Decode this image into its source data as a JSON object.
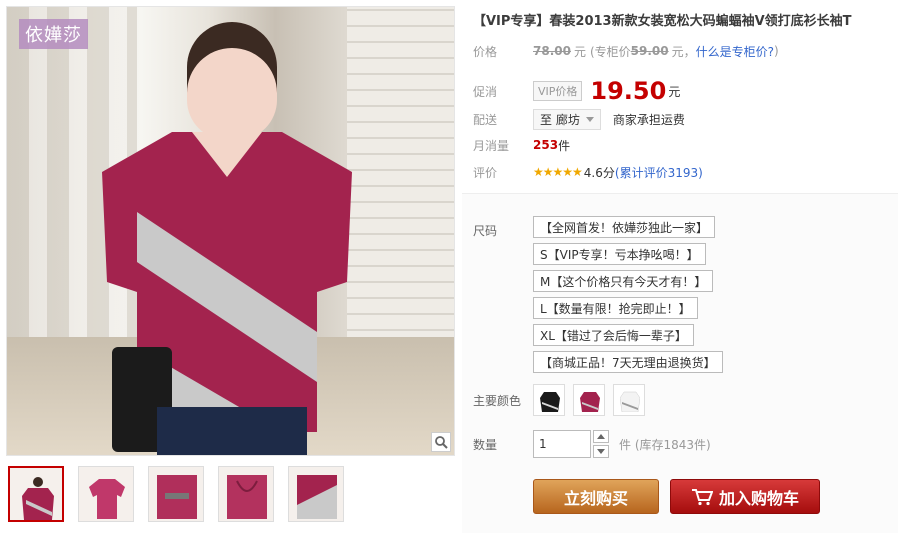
{
  "brand": {
    "logo_text": "依嬅莎"
  },
  "product": {
    "title": "【VIP专享】春装2013新款女装宽松大码蝙蝠袖V领打底衫长袖T"
  },
  "price": {
    "label": "价格",
    "original": "78.00",
    "unit": "元",
    "counter_text": "(专柜价",
    "counter_price": "59.00",
    "counter_unit": "元，",
    "counter_link": "什么是专柜价?",
    "counter_close": ")"
  },
  "promo": {
    "label": "促消",
    "tag": "VIP价格",
    "price": "19.50",
    "unit": "元"
  },
  "delivery": {
    "label": "配送",
    "city": "至 廊坊",
    "note": "商家承担运费"
  },
  "sales": {
    "label": "月消量",
    "count": "253",
    "unit": "件"
  },
  "rating": {
    "label": "评价",
    "stars": "★★★★★",
    "score": "4.6分",
    "reviews_link": "(累计评价3193)"
  },
  "options": {
    "size_label": "尺码",
    "sizes": [
      "【全网首发！依嬅莎独此一家】",
      "S【VIP专享！亏本挣吆喝！】",
      "M【这个价格只有今天才有！】",
      "L【数量有限！抢完即止！】",
      "XL【错过了会后悔一辈子】",
      "【商城正品！7天无理由退换货】"
    ],
    "color_label": "主要颜色",
    "colors": [
      {
        "name": "black-white",
        "main": "#1a1a1a",
        "stripe": "#d8d8d8"
      },
      {
        "name": "rose-grey",
        "main": "#a3234e",
        "stripe": "#c9c9c9"
      },
      {
        "name": "white-grey",
        "main": "#f3f3f3",
        "stripe": "#9a9a9a"
      }
    ],
    "qty_label": "数量",
    "qty_value": "1",
    "stock": "件 (库存1843件)"
  },
  "actions": {
    "buy_now": "立刻购买",
    "add_cart": "加入购物车"
  },
  "colors": {
    "accent_red": "#c40000",
    "shirt_rose": "#a3234e",
    "shirt_grey": "#c9c9c9"
  }
}
